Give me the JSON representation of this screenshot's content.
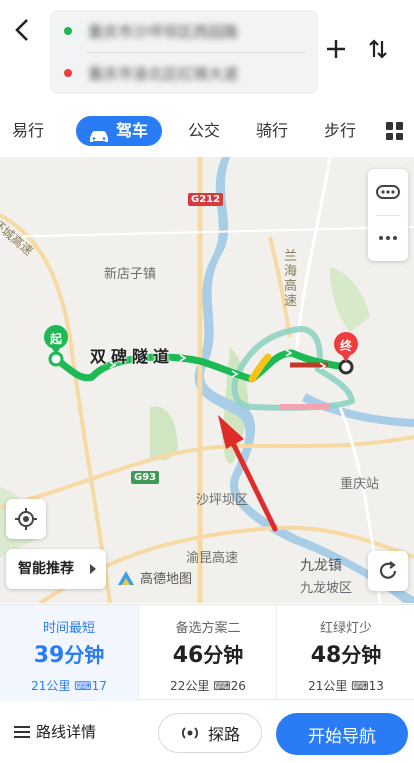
{
  "header": {
    "back_icon": "back-arrow-icon",
    "origin_text": "重庆市沙坪坝区西园路",
    "destination_text": "重庆市渝北区红锦大道",
    "origin_color": "#1db954",
    "destination_color": "#f03c3c",
    "add_icon": "plus-icon",
    "swap_icon": "swap-icon"
  },
  "tabs": [
    {
      "label": "易行"
    },
    {
      "label": "驾车"
    },
    {
      "label": "公交"
    },
    {
      "label": "骑行"
    },
    {
      "label": "步行"
    }
  ],
  "map": {
    "labels": {
      "town_xindianzi": "新店子镇",
      "tunnel": "双碑隧道",
      "shapingba": "沙坪坝区",
      "yukun": "渝昆高速",
      "jiulongzhen": "九龙镇",
      "jiulongpo": "九龙坡区",
      "chongqing_station": "重庆站",
      "lanhai": "兰海高速",
      "ring": "环城高速",
      "start_marker": "起",
      "end_marker": "终",
      "g212": "G212",
      "g93": "G93",
      "logo": "高德地图"
    },
    "smart_recommend": "智能推荐",
    "route_color": "#1db954",
    "alt_route_color": "#8fd3c4"
  },
  "options": [
    {
      "label": "时间最短",
      "time": "39",
      "unit": "分钟",
      "distance": "21公里",
      "lights": "17",
      "active": true
    },
    {
      "label": "备选方案二",
      "time": "46",
      "unit": "分钟",
      "distance": "22公里",
      "lights": "26",
      "active": false
    },
    {
      "label": "红绿灯少",
      "time": "48",
      "unit": "分钟",
      "distance": "21公里",
      "lights": "13",
      "active": false
    }
  ],
  "bottom": {
    "details_label": "路线详情",
    "explore_label": "探路",
    "start_label": "开始导航",
    "accent": "#2a7cf6"
  }
}
